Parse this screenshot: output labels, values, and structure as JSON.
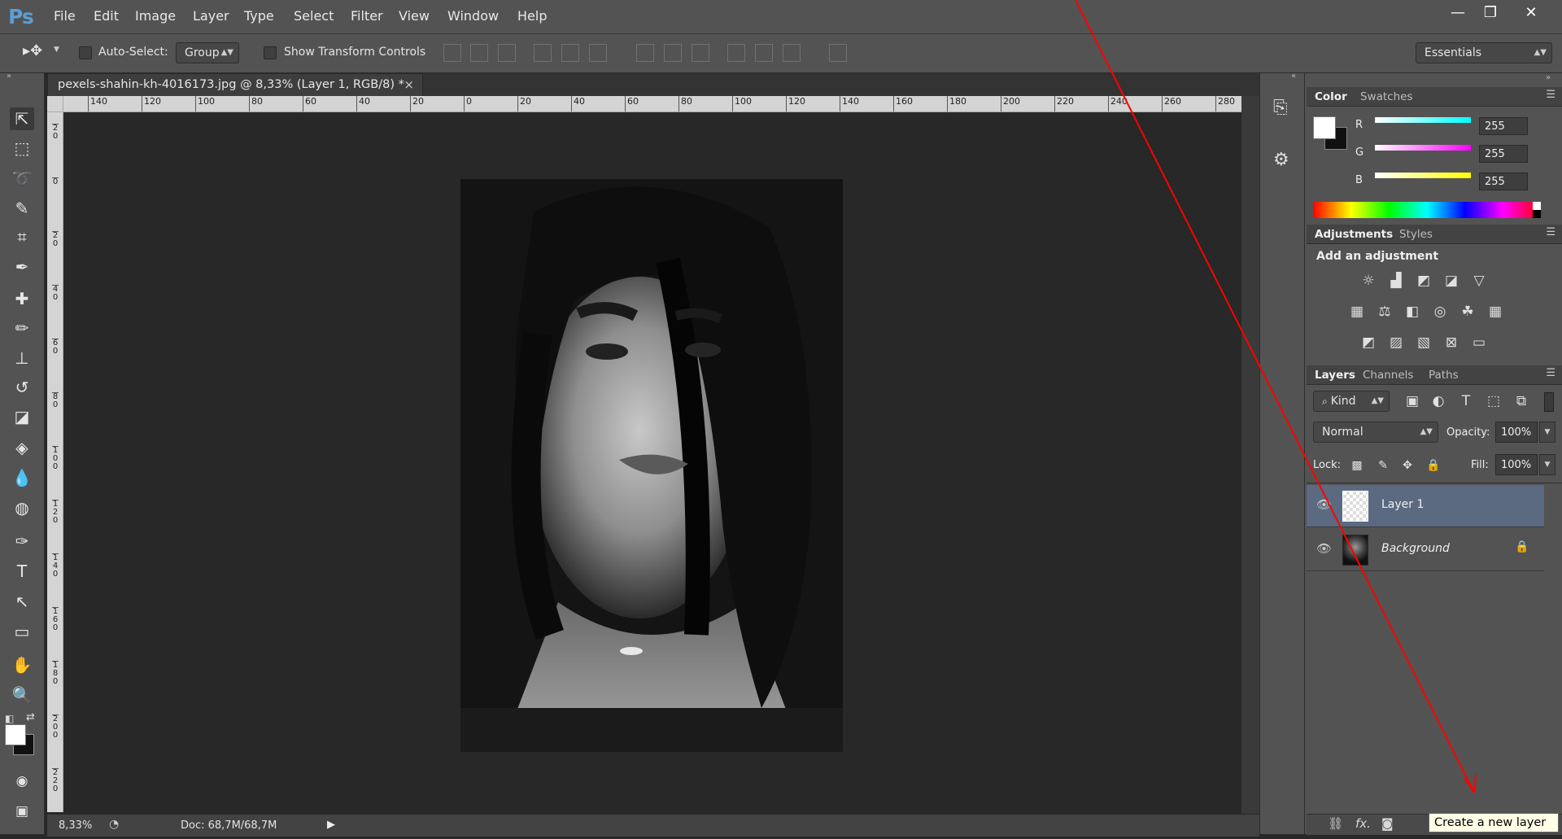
{
  "app": {
    "logo": "Ps"
  },
  "menu": [
    "File",
    "Edit",
    "Image",
    "Layer",
    "Type",
    "Select",
    "Filter",
    "View",
    "Window",
    "Help"
  ],
  "window_buttons": [
    "—",
    "❐",
    "✕"
  ],
  "options": {
    "auto_select_label": "Auto-Select:",
    "group_value": "Group",
    "show_transform_label": "Show Transform Controls",
    "workspace": "Essentials"
  },
  "document": {
    "tab_title": "pexels-shahin-kh-4016173.jpg @ 8,33% (Layer 1, RGB/8) *",
    "close": "×",
    "zoom": "8,33%",
    "doc_size": "Doc: 68,7M/68,7M"
  },
  "rulers": {
    "h_labels": [
      "140",
      "120",
      "100",
      "80",
      "60",
      "40",
      "20",
      "0",
      "20",
      "40",
      "60",
      "80",
      "100",
      "120",
      "140",
      "160",
      "180",
      "200",
      "220",
      "240",
      "260",
      "280"
    ],
    "v_labels": [
      "2 0",
      "0",
      "2 0",
      "4 0",
      "6 0",
      "8 0",
      "1 0 0",
      "1 2 0",
      "1 4 0",
      "1 6 0",
      "1 8 0",
      "2 0 0",
      "2 2 0"
    ]
  },
  "color_panel": {
    "tabs": [
      "Color",
      "Swatches"
    ],
    "channels": [
      {
        "label": "R",
        "value": "255",
        "gradient": "#00ffff"
      },
      {
        "label": "G",
        "value": "255",
        "gradient": "#ff00ff"
      },
      {
        "label": "B",
        "value": "255",
        "gradient": "#ffff00"
      }
    ]
  },
  "adjustments_panel": {
    "tabs": [
      "Adjustments",
      "Styles"
    ],
    "heading": "Add an adjustment"
  },
  "layers_panel": {
    "tabs": [
      "Layers",
      "Channels",
      "Paths"
    ],
    "filter_kind": "Kind",
    "blend_mode": "Normal",
    "opacity_label": "Opacity:",
    "opacity_value": "100%",
    "lock_label": "Lock:",
    "fill_label": "Fill:",
    "fill_value": "100%",
    "layers": [
      {
        "name": "Layer 1",
        "selected": true
      },
      {
        "name": "Background",
        "locked": true
      }
    ]
  },
  "tooltip": "Create a new layer",
  "colors": {
    "accent_selected_layer": "#5b6a80",
    "annotation_line": "#ff0000"
  }
}
